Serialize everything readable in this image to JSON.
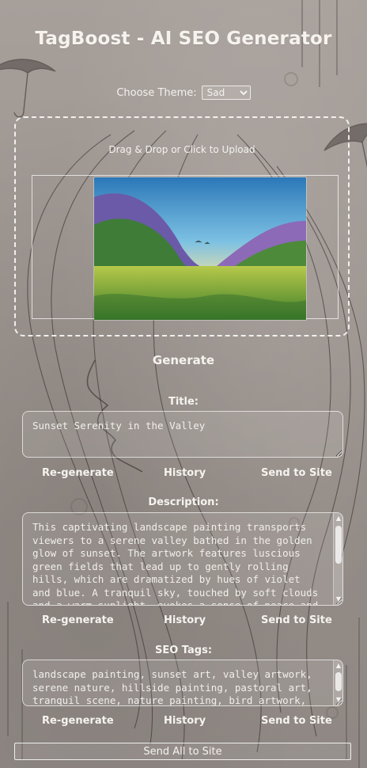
{
  "header": {
    "title": "TagBoost - AI SEO Generator"
  },
  "theme": {
    "label": "Choose Theme:",
    "selected": "Sad"
  },
  "upload": {
    "hint": "Drag & Drop or Click to Upload"
  },
  "actions": {
    "generate_label": "Generate",
    "regenerate_label": "Re-generate",
    "history_label": "History",
    "send_to_site_label": "Send to Site",
    "send_all_label": "Send All to Site"
  },
  "sections": {
    "title": {
      "heading": "Title:",
      "value": "Sunset Serenity in the Valley"
    },
    "description": {
      "heading": "Description:",
      "value": "This captivating landscape painting transports viewers to a serene valley bathed in the golden glow of sunset. The artwork features luscious green fields that lead up to gently rolling hills, which are dramatized by hues of violet and blue. A tranquil sky, touched by soft clouds and a warm sunlight, evokes a sense of peace and harmony..."
    },
    "seo_tags": {
      "heading": "SEO Tags:",
      "value": "landscape painting, sunset art, valley artwork, serene nature, hillside painting, pastoral art, tranquil scene, nature painting, bird artwork,"
    }
  },
  "colors": {
    "text": "#f6f3ef",
    "background": "#9c948f",
    "border": "#ffffff"
  },
  "icons": {
    "scroll_up": "triangle-up",
    "scroll_down": "triangle-down"
  }
}
